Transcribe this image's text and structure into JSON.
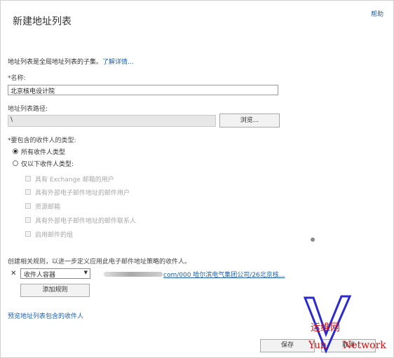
{
  "header": {
    "title": "新建地址列表",
    "help": "帮助"
  },
  "intro": {
    "text": "地址列表是全局地址列表的子集。",
    "learn_more": "了解详情..."
  },
  "name_field": {
    "label": "*名称:",
    "value": "北京核电设计院"
  },
  "path_field": {
    "label": "地址列表路径:",
    "value": "\\",
    "browse_label": "浏览..."
  },
  "recipient_types": {
    "label": "*要包含的收件人的类型:",
    "options": [
      "所有收件人类型",
      "仅以下收件人类型:"
    ],
    "selected_index": 0,
    "checkboxes": [
      "具有 Exchange 邮箱的用户",
      "具有外部电子邮件地址的邮件用户",
      "资源邮箱",
      "具有外部电子邮件地址的邮件联系人",
      "启用邮件的组"
    ]
  },
  "rules": {
    "intro": "创建相关规则，以进一步定义应用此电子邮件地址策略的收件人。",
    "remove_glyph": "✕",
    "condition": "收件人容器",
    "value_text": "com/000 哈尔滨电气集团公司/26北京核...",
    "add_rule": "添加规则"
  },
  "preview_link": "预览地址列表包含的收件人",
  "footer": {
    "save": "保存",
    "cancel": "取消"
  },
  "watermark": {
    "cn": "运维网",
    "en_left": "Yun",
    "en_right": "Network"
  },
  "icons": {
    "dropdown": "chevron-down-icon",
    "remove": "close-icon",
    "logo": "v-logo-icon"
  }
}
